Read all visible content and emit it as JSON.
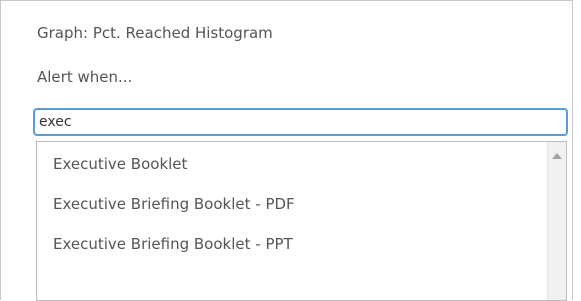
{
  "graph_label": "Graph: Pct. Reached Histogram",
  "alert_label": "Alert when...",
  "search": {
    "value": "exec",
    "placeholder": ""
  },
  "suggestions": [
    {
      "label": "Executive Booklet"
    },
    {
      "label": "Executive Briefing Booklet - PDF"
    },
    {
      "label": "Executive Briefing Booklet - PPT"
    }
  ],
  "icons": {
    "scroll_up": "chevron-up-icon"
  },
  "colors": {
    "input_focus_border": "#5b9bd5",
    "text": "#555555"
  }
}
